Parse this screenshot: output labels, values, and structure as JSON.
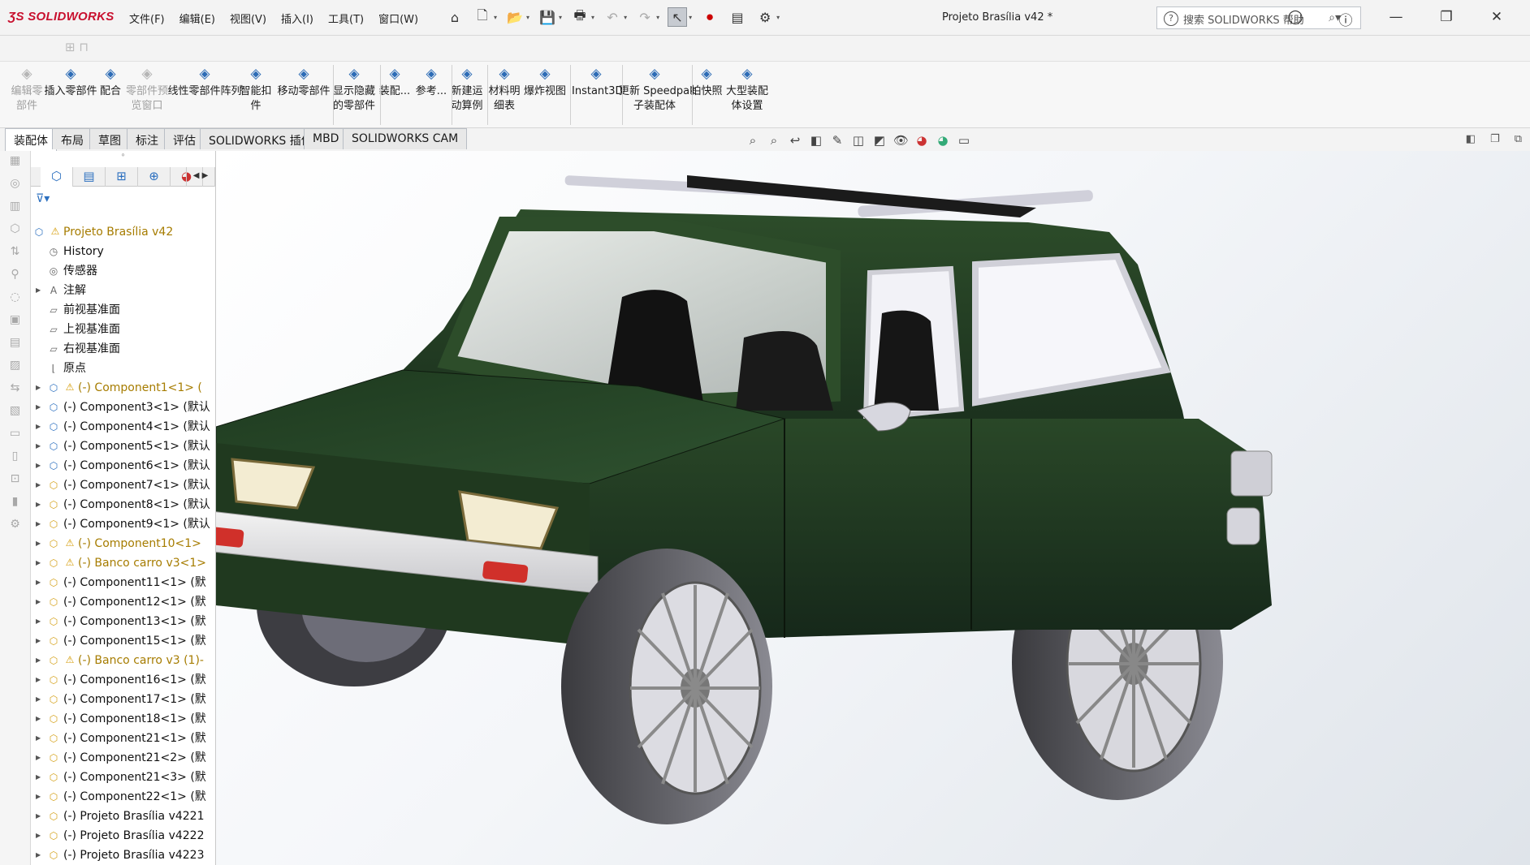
{
  "app": {
    "logo": "SOLIDWORKS",
    "document_title": "Projeto Brasília v42 *"
  },
  "menu": [
    "文件(F)",
    "编辑(E)",
    "视图(V)",
    "插入(I)",
    "工具(T)",
    "窗口(W)"
  ],
  "search": {
    "placeholder": "搜索 SOLIDWORKS 帮助"
  },
  "ribbon": [
    {
      "label": "编辑零\n部件",
      "icon": "edit-component-icon",
      "enabled": false
    },
    {
      "label": "插入零部件",
      "icon": "insert-component-icon",
      "enabled": true
    },
    {
      "label": "配合",
      "icon": "mate-icon",
      "enabled": true
    },
    {
      "label": "零部件预\n览窗口",
      "icon": "preview-window-icon",
      "enabled": false
    },
    {
      "label": "线性零部件阵列",
      "icon": "linear-pattern-icon",
      "enabled": true
    },
    {
      "label": "智能扣\n件",
      "icon": "smart-fastener-icon",
      "enabled": true
    },
    {
      "label": "移动零部件",
      "icon": "move-component-icon",
      "enabled": true
    },
    {
      "label": "显示隐藏\n的零部件",
      "icon": "show-hidden-icon",
      "enabled": true
    },
    {
      "label": "装配...",
      "icon": "assembly-feature-icon",
      "enabled": true
    },
    {
      "label": "参考...",
      "icon": "reference-geometry-icon",
      "enabled": true
    },
    {
      "label": "新建运\n动算例",
      "icon": "motion-study-icon",
      "enabled": true
    },
    {
      "label": "材料明\n细表",
      "icon": "bom-icon",
      "enabled": true
    },
    {
      "label": "爆炸视图",
      "icon": "exploded-view-icon",
      "enabled": true
    },
    {
      "label": "Instant3D",
      "icon": "instant3d-icon",
      "enabled": true
    },
    {
      "label": "更新 Speedpak\n子装配体",
      "icon": "speedpak-icon",
      "enabled": true
    },
    {
      "label": "拍快照",
      "icon": "snapshot-icon",
      "enabled": true
    },
    {
      "label": "大型装配\n体设置",
      "icon": "large-assembly-icon",
      "enabled": true
    }
  ],
  "tabs": [
    "装配体",
    "布局",
    "草图",
    "标注",
    "评估",
    "SOLIDWORKS 插件",
    "MBD",
    "SOLIDWORKS CAM"
  ],
  "active_tab": "装配体",
  "tree": [
    {
      "label": "Projeto Brasília v42",
      "kind": "root",
      "warn": true
    },
    {
      "label": "History",
      "kind": "history"
    },
    {
      "label": "传感器",
      "kind": "sensor"
    },
    {
      "label": "注解",
      "kind": "annotation",
      "expand": true
    },
    {
      "label": "前视基准面",
      "kind": "plane"
    },
    {
      "label": "上视基准面",
      "kind": "plane"
    },
    {
      "label": "右视基准面",
      "kind": "plane"
    },
    {
      "label": "原点",
      "kind": "origin"
    },
    {
      "label": "(-) Component1<1> (",
      "kind": "part",
      "warn": true,
      "yellow": true
    },
    {
      "label": "(-) Component3<1> (默认",
      "kind": "part"
    },
    {
      "label": "(-) Component4<1> (默认",
      "kind": "part"
    },
    {
      "label": "(-) Component5<1> (默认",
      "kind": "part"
    },
    {
      "label": "(-) Component6<1> (默认",
      "kind": "part"
    },
    {
      "label": "(-) Component7<1> (默认",
      "kind": "asm"
    },
    {
      "label": "(-) Component8<1> (默认",
      "kind": "asm"
    },
    {
      "label": "(-) Component9<1> (默认",
      "kind": "asm"
    },
    {
      "label": "(-) Component10<1>",
      "kind": "asm",
      "warn": true,
      "yellow": true
    },
    {
      "label": "(-) Banco carro v3<1>",
      "kind": "asm",
      "warn": true,
      "yellow": true
    },
    {
      "label": "(-) Component11<1> (默",
      "kind": "asm"
    },
    {
      "label": "(-) Component12<1> (默",
      "kind": "asm"
    },
    {
      "label": "(-) Component13<1> (默",
      "kind": "asm"
    },
    {
      "label": "(-) Component15<1> (默",
      "kind": "asm"
    },
    {
      "label": "(-) Banco carro v3 (1)-",
      "kind": "asm",
      "warn": true,
      "yellow": true
    },
    {
      "label": "(-) Component16<1> (默",
      "kind": "asm"
    },
    {
      "label": "(-) Component17<1> (默",
      "kind": "asm"
    },
    {
      "label": "(-) Component18<1> (默",
      "kind": "asm"
    },
    {
      "label": "(-) Component21<1> (默",
      "kind": "asm"
    },
    {
      "label": "(-) Component21<2> (默",
      "kind": "asm"
    },
    {
      "label": "(-) Component21<3> (默",
      "kind": "asm"
    },
    {
      "label": "(-) Component22<1> (默",
      "kind": "asm"
    },
    {
      "label": "(-) Projeto Brasília v4221",
      "kind": "asm"
    },
    {
      "label": "(-) Projeto Brasília v4222",
      "kind": "asm"
    },
    {
      "label": "(-) Projeto Brasília v4223",
      "kind": "asm"
    }
  ],
  "colors": {
    "car_body": "#1f3a1f",
    "brand_red": "#c8102e",
    "accent_blue": "#2b6fbf",
    "warning": "#d49a00"
  }
}
